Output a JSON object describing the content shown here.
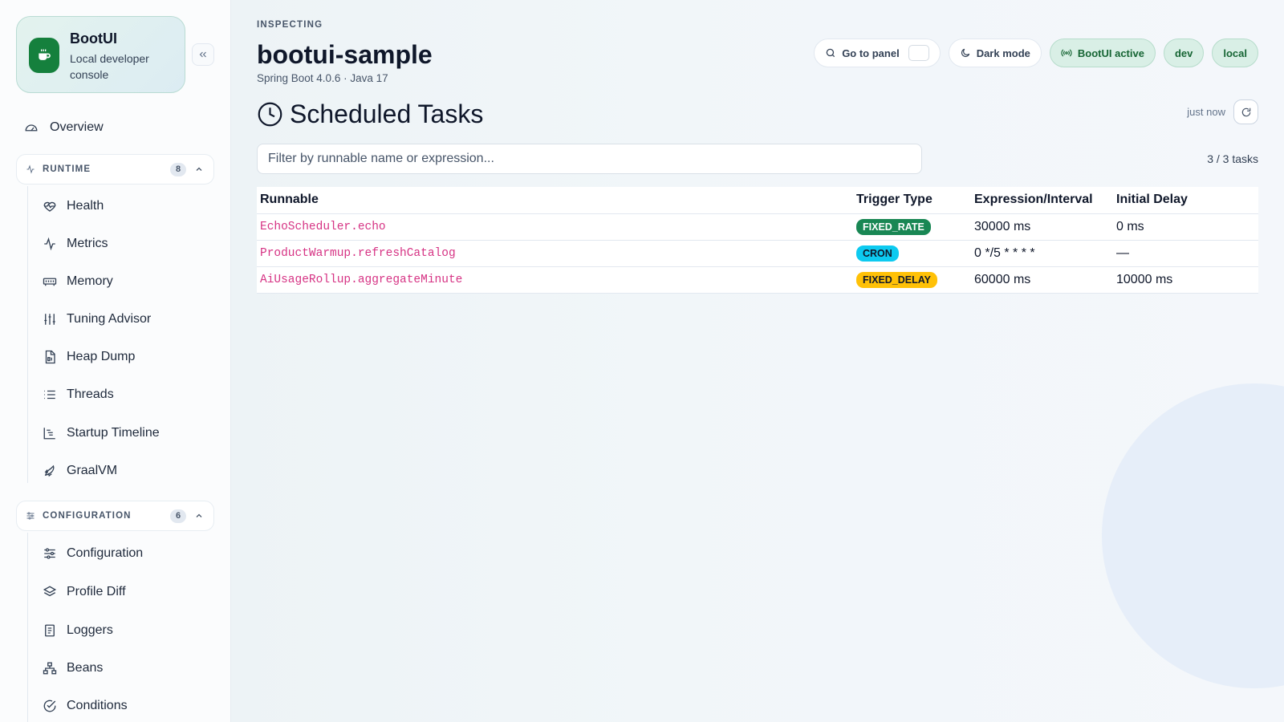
{
  "sidebar": {
    "brand": {
      "title": "BootUI",
      "subtitle": "Local developer console"
    },
    "overview": "Overview",
    "groups": [
      {
        "title": "RUNTIME",
        "count": "8",
        "items": [
          {
            "label": "Health",
            "icon": "heart-pulse-icon"
          },
          {
            "label": "Metrics",
            "icon": "activity-icon"
          },
          {
            "label": "Memory",
            "icon": "memory-chip-icon"
          },
          {
            "label": "Tuning Advisor",
            "icon": "sliders-vertical-icon"
          },
          {
            "label": "Heap Dump",
            "icon": "file-binary-icon"
          },
          {
            "label": "Threads",
            "icon": "list-icon"
          },
          {
            "label": "Startup Timeline",
            "icon": "gantt-icon"
          },
          {
            "label": "GraalVM",
            "icon": "rocket-icon"
          }
        ]
      },
      {
        "title": "CONFIGURATION",
        "count": "6",
        "items": [
          {
            "label": "Configuration",
            "icon": "sliders-horizontal-icon"
          },
          {
            "label": "Profile Diff",
            "icon": "layers-icon"
          },
          {
            "label": "Loggers",
            "icon": "notebook-icon"
          },
          {
            "label": "Beans",
            "icon": "network-icon"
          },
          {
            "label": "Conditions",
            "icon": "check-circle-icon"
          }
        ]
      }
    ]
  },
  "header": {
    "inspecting_label": "INSPECTING",
    "app_name": "bootui-sample",
    "app_meta": "Spring Boot 4.0.6 · Java 17",
    "go_to_panel": "Go to panel",
    "dark_mode": "Dark mode",
    "status": "BootUI active",
    "profiles": [
      "dev",
      "local"
    ]
  },
  "page": {
    "title": "Scheduled Tasks",
    "last_refresh": "just now",
    "filter_placeholder": "Filter by runnable name or expression...",
    "count": "3 / 3 tasks"
  },
  "table": {
    "columns": [
      "Runnable",
      "Trigger Type",
      "Expression/Interval",
      "Initial Delay"
    ],
    "rows": [
      {
        "runnable": "EchoScheduler.echo",
        "trigger": "FIXED_RATE",
        "expression": "30000 ms",
        "delay": "0 ms"
      },
      {
        "runnable": "ProductWarmup.refreshCatalog",
        "trigger": "CRON",
        "expression": "0 */5 * * * *",
        "delay": "—"
      },
      {
        "runnable": "AiUsageRollup.aggregateMinute",
        "trigger": "FIXED_DELAY",
        "expression": "60000 ms",
        "delay": "10000 ms"
      }
    ]
  },
  "colors": {
    "accent": "#15803d",
    "fixed_rate_badge": "#198754",
    "cron_badge": "#0dcaf0",
    "fixed_delay_badge": "#ffc107",
    "code_text": "#d63384"
  }
}
